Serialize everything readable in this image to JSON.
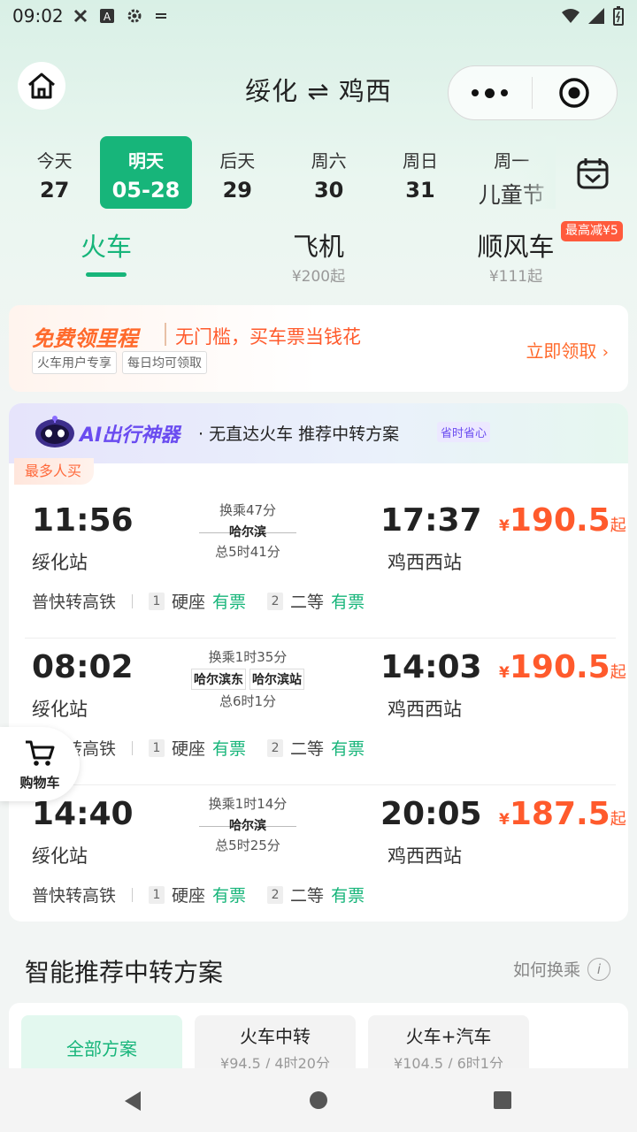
{
  "status_bar": {
    "time": "09:02"
  },
  "header": {
    "route": "绥化 ⇌ 鸡西"
  },
  "dates": [
    {
      "label": "今天",
      "date": "27"
    },
    {
      "label": "明天",
      "date": "05-28"
    },
    {
      "label": "后天",
      "date": "29"
    },
    {
      "label": "周六",
      "date": "30"
    },
    {
      "label": "周日",
      "date": "31"
    },
    {
      "label": "周一",
      "date": "儿童节"
    }
  ],
  "modes": {
    "train": {
      "label": "火车"
    },
    "plane": {
      "label": "飞机",
      "sub": "¥200起"
    },
    "carpool": {
      "label": "顺风车",
      "sub": "¥111起",
      "badge": "最高减¥5"
    }
  },
  "mileage": {
    "title": "免费领里程",
    "slogan": "无门槛，买车票当钱花",
    "tags": [
      "火车用户专享",
      "每日均可领取"
    ],
    "claim": "立即领取"
  },
  "ai": {
    "title": "AI出行神器",
    "subtitle": "· 无直达火车 推荐中转方案",
    "tag": "省时省心",
    "hot_label": "最多人买"
  },
  "trips": [
    {
      "dep": "11:56",
      "dep_station": "绥化站",
      "transfer": "换乘47分",
      "via": [
        "哈尔滨"
      ],
      "duration": "总5时41分",
      "arr": "17:37",
      "arr_station": "鸡西西站",
      "currency": "¥",
      "price": "190.5",
      "qi": "起",
      "type": "普快转高铁",
      "seat1": "硬座",
      "seat1_status": "有票",
      "seat2": "二等",
      "seat2_status": "有票"
    },
    {
      "dep": "08:02",
      "dep_station": "绥化站",
      "transfer": "换乘1时35分",
      "via": [
        "哈尔滨东",
        "哈尔滨站"
      ],
      "duration": "总6时1分",
      "arr": "14:03",
      "arr_station": "鸡西西站",
      "currency": "¥",
      "price": "190.5",
      "qi": "起",
      "type": "普快转高铁",
      "seat1": "硬座",
      "seat1_status": "有票",
      "seat2": "二等",
      "seat2_status": "有票"
    },
    {
      "dep": "14:40",
      "dep_station": "绥化站",
      "transfer": "换乘1时14分",
      "via": [
        "哈尔滨"
      ],
      "duration": "总5时25分",
      "arr": "20:05",
      "arr_station": "鸡西西站",
      "currency": "¥",
      "price": "187.5",
      "qi": "起",
      "type": "普快转高铁",
      "seat1": "硬座",
      "seat1_status": "有票",
      "seat2": "二等",
      "seat2_status": "有票"
    }
  ],
  "cart": {
    "label": "购物车"
  },
  "section": {
    "title": "智能推荐中转方案",
    "how": "如何换乘"
  },
  "plans": [
    {
      "label": "全部方案"
    },
    {
      "label": "火车中转",
      "price": "¥94.5",
      "time": "4时20分"
    },
    {
      "label": "火车+汽车",
      "price": "¥104.5",
      "time": "6时1分"
    }
  ],
  "colors": {
    "accent": "#17b57a",
    "price": "#ff5a2c",
    "ai": "#6a4cf0"
  },
  "icons": [
    "home-icon",
    "more-icon",
    "target-icon",
    "calendar-icon",
    "chevron-right-icon",
    "ai-robot-icon",
    "cart-icon",
    "info-icon",
    "back-icon",
    "home-circle-icon",
    "recents-icon"
  ]
}
